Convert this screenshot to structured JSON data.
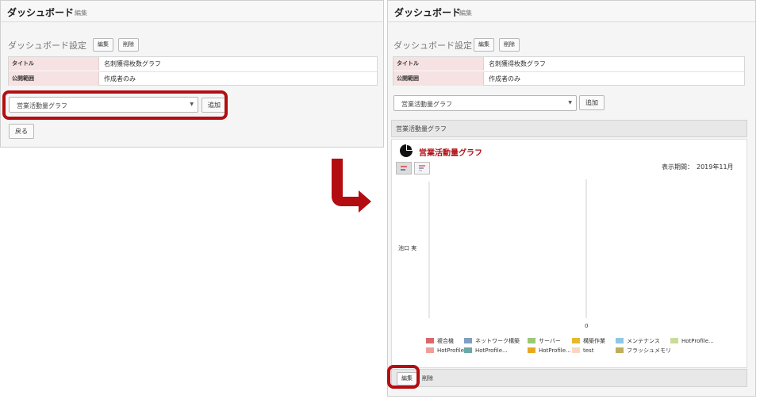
{
  "left": {
    "header_title": "ダッシュボード",
    "header_edit": "編集",
    "section_title": "ダッシュボード設定",
    "edit_button": "編集",
    "delete_button": "削除",
    "rows": [
      {
        "label": "タイトル",
        "value": "名刺獲得枚数グラフ"
      },
      {
        "label": "公開範囲",
        "value": "作成者のみ"
      }
    ],
    "select_value": "営業活動量グラフ",
    "add_button": "追加",
    "back_button": "戻る"
  },
  "right": {
    "header_title": "ダッシュボード",
    "header_edit": "編集",
    "section_title": "ダッシュボード設定",
    "edit_button": "編集",
    "delete_button": "削除",
    "rows": [
      {
        "label": "タイトル",
        "value": "名刺獲得枚数グラフ"
      },
      {
        "label": "公開範囲",
        "value": "作成者のみ"
      }
    ],
    "select_value": "営業活動量グラフ",
    "add_button": "追加",
    "card_header": "営業活動量グラフ",
    "chart_title": "営業活動量グラフ",
    "period_label": "表示期間：",
    "period_value": "2019年11月",
    "footer_edit": "編集",
    "footer_delete": "削除"
  },
  "colors": {
    "accent_red": "#b30d12",
    "row_header_bg": "#f6e2e2",
    "chart_title_color": "#b11116"
  },
  "chart_data": {
    "type": "bar",
    "orientation": "horizontal",
    "categories": [
      "池口 実"
    ],
    "x_tick_labels": [
      "0"
    ],
    "series": [
      {
        "name": "複合機",
        "color": "#d9686a",
        "values": [
          0
        ]
      },
      {
        "name": "ネットワーク構築",
        "color": "#7f9fc4",
        "values": [
          0
        ]
      },
      {
        "name": "サーバー",
        "color": "#9bc876",
        "values": [
          0
        ]
      },
      {
        "name": "構築作業",
        "color": "#e6b92e",
        "values": [
          0
        ]
      },
      {
        "name": "メンテナンス",
        "color": "#8fc7e6",
        "values": [
          0
        ]
      },
      {
        "name": "HotProfile...",
        "color": "#c9dc98",
        "values": [
          0
        ]
      },
      {
        "name": "HotProfile...",
        "color": "#ee9f9a",
        "values": [
          0
        ]
      },
      {
        "name": "HotProfile...",
        "color": "#6aa9a7",
        "values": [
          0
        ]
      },
      {
        "name": "HotProfile...",
        "color": "#e8a921",
        "values": [
          0
        ]
      },
      {
        "name": "test",
        "color": "#f8d6c4",
        "values": [
          0
        ]
      },
      {
        "name": "フラッシュメモリ",
        "color": "#bfae5b",
        "values": [
          0
        ]
      }
    ],
    "legend_position": "bottom"
  }
}
